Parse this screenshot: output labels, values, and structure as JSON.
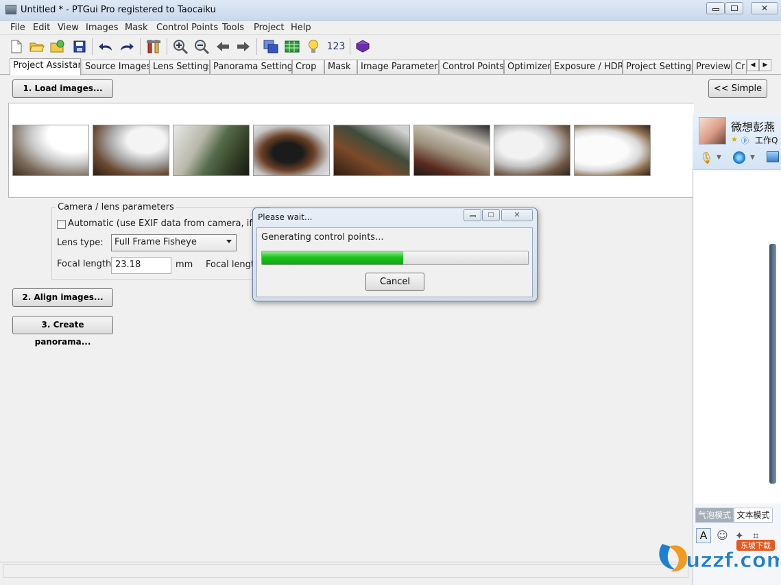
{
  "window": {
    "title": "Untitled * - PTGui Pro registered to Taocaiku",
    "controls": [
      "▭",
      "▢",
      "✕"
    ]
  },
  "menu": [
    "File",
    "Edit",
    "View",
    "Images",
    "Mask",
    "Control Points",
    "Tools",
    "Project",
    "Help"
  ],
  "toolbar": {
    "icons": [
      "new-file-icon",
      "open-folder-icon",
      "open-recent-icon",
      "save-icon",
      "undo-icon",
      "redo-icon",
      "tools-icon",
      "zoom-in-icon",
      "zoom-out-icon",
      "arrow-left-icon",
      "arrow-right-icon",
      "panorama-editor-icon",
      "table-icon",
      "bulb-icon",
      "numbering-icon",
      "help-book-icon"
    ],
    "numbering_label": "123"
  },
  "tabs": [
    "Project Assistant",
    "Source Images",
    "Lens Settings",
    "Panorama Settings",
    "Crop",
    "Mask",
    "Image Parameters",
    "Control Points",
    "Optimizer",
    "Exposure / HDR",
    "Project Settings",
    "Preview",
    "Cr"
  ],
  "tab_scroll": [
    "◀",
    "▶"
  ],
  "active_tab": "Project Assistant",
  "assistant": {
    "load_button": "1. Load images...",
    "simple_button": "<< Simple",
    "align_button": "2. Align images...",
    "create_button": "3. Create panorama..."
  },
  "camera": {
    "group_label": "Camera / lens parameters",
    "automatic_label": "Automatic (use EXIF data from camera, if avail",
    "automatic_checked": false,
    "lens_type_label": "Lens type:",
    "lens_type_value": "Full Frame Fisheye",
    "focal_length_label": "Focal length:",
    "focal_length_value": "23.18",
    "focal_unit": "mm",
    "focal_length_label2": "Focal length"
  },
  "dialog": {
    "title": "Please wait...",
    "message": "Generating control points...",
    "progress": 0.53,
    "cancel_button": "Cancel"
  },
  "qq": {
    "name": "微想彭燕",
    "status": "工作Q",
    "tab_bubble": "气泡模式",
    "tab_text": "文本模式"
  },
  "watermark": {
    "brand": "uzzf.com",
    "sub": "东坡下载"
  }
}
